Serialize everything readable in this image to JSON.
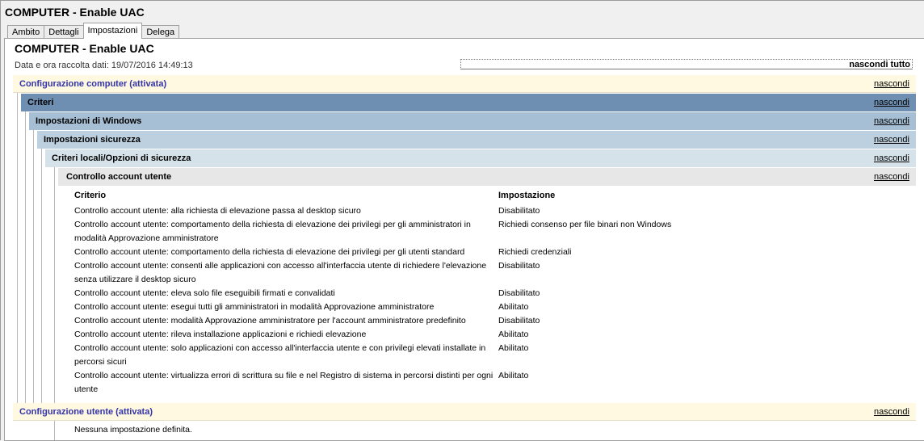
{
  "window": {
    "title": "COMPUTER - Enable UAC"
  },
  "tabs": [
    {
      "label": "Ambito"
    },
    {
      "label": "Dettagli"
    },
    {
      "label": "Impostazioni"
    },
    {
      "label": "Delega"
    }
  ],
  "report": {
    "title": "COMPUTER - Enable UAC",
    "date": "Data e ora raccolta dati: 19/07/2016 14:49:13",
    "hide_all": "nascondi tutto",
    "hide": "nascondi",
    "computer_config": "Configurazione computer (attivata)",
    "criteri": "Criteri",
    "windows_settings": "Impostazioni di Windows",
    "security_settings": "Impostazioni sicurezza",
    "local_policies": "Criteri locali/Opzioni di sicurezza",
    "uac": "Controllo account utente",
    "col_policy": "Criterio",
    "col_setting": "Impostazione",
    "rows": [
      {
        "policy": "Controllo account utente: alla richiesta di elevazione passa al desktop sicuro",
        "setting": "Disabilitato"
      },
      {
        "policy": "Controllo account utente: comportamento della richiesta di elevazione dei privilegi per gli amministratori in modalità Approvazione amministratore",
        "setting": "Richiedi consenso per file binari non Windows"
      },
      {
        "policy": "Controllo account utente: comportamento della richiesta di elevazione dei privilegi per gli utenti standard",
        "setting": "Richiedi credenziali"
      },
      {
        "policy": "Controllo account utente: consenti alle applicazioni con accesso all'interfaccia utente di richiedere l'elevazione senza utilizzare il desktop sicuro",
        "setting": "Disabilitato"
      },
      {
        "policy": "Controllo account utente: eleva solo file eseguibili firmati e convalidati",
        "setting": "Disabilitato"
      },
      {
        "policy": "Controllo account utente: esegui tutti gli amministratori in modalità Approvazione amministratore",
        "setting": "Abilitato"
      },
      {
        "policy": "Controllo account utente: modalità Approvazione amministratore per l'account amministratore predefinito",
        "setting": "Disabilitato"
      },
      {
        "policy": "Controllo account utente: rileva installazione applicazioni e richiedi elevazione",
        "setting": "Abilitato"
      },
      {
        "policy": "Controllo account utente: solo applicazioni con accesso all'interfaccia utente e con privilegi elevati installate in percorsi sicuri",
        "setting": "Abilitato"
      },
      {
        "policy": "Controllo account utente: virtualizza errori di scrittura su file e nel Registro di sistema in percorsi distinti per ogni utente",
        "setting": "Abilitato"
      }
    ],
    "user_config": "Configurazione utente (attivata)",
    "no_settings": "Nessuna impostazione definita."
  }
}
